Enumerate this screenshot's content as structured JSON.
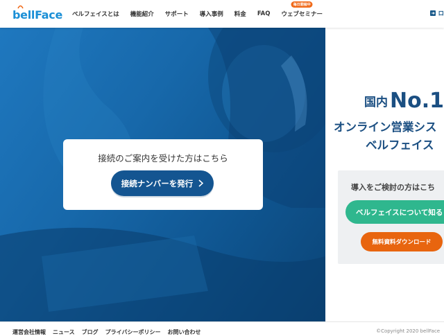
{
  "header": {
    "logo_text": "bellFace",
    "nav": [
      {
        "label": "ベルフェイスとは"
      },
      {
        "label": "機能紹介"
      },
      {
        "label": "サポート"
      },
      {
        "label": "導入事例"
      },
      {
        "label": "料金"
      },
      {
        "label": "FAQ"
      },
      {
        "label": "ウェブセミナー",
        "badge": "毎日開催中"
      }
    ],
    "login_label": "ロ",
    "accent_color": "#1b8fd6"
  },
  "hero": {
    "card_title": "接続のご案内を受けた方はこちら",
    "connect_button": "接続ナンバーを発行",
    "chevron_icon": "chevron-right-icon",
    "bg_color": "#1768aa"
  },
  "right": {
    "no1_prefix": "国内",
    "no1_big": "No.1",
    "tagline": "オンライン営業シス",
    "brand_line": "ベルフェイス",
    "consider_title": "導入をご検討の方はこち",
    "about_button": "ベルフェイスについて知る",
    "download_button": "無料資料ダウンロード",
    "about_color": "#2fb78e",
    "download_color": "#e8650f"
  },
  "footer": {
    "links": [
      "運営会社情報",
      "ニュース",
      "ブログ",
      "プライバシーポリシー",
      "お問い合わせ"
    ],
    "copyright": "©Copyright 2020 bellFace"
  }
}
